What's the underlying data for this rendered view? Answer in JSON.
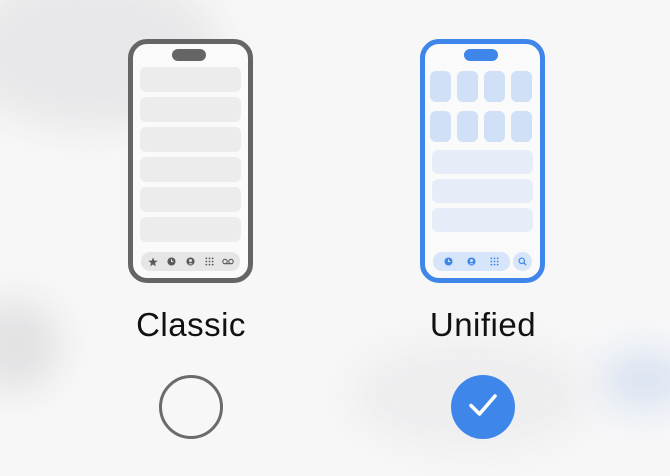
{
  "colors": {
    "accent": "#3e86ea",
    "neutral": "#656565"
  },
  "options": [
    {
      "id": "classic",
      "label": "Classic",
      "selected": false,
      "tab_icons": [
        "star-icon",
        "clock-icon",
        "person-icon",
        "keypad-icon",
        "voicemail-icon"
      ]
    },
    {
      "id": "unified",
      "label": "Unified",
      "selected": true,
      "tab_icons": [
        "clock-icon",
        "person-icon",
        "keypad-icon"
      ],
      "extra_icon": "search-icon"
    }
  ]
}
